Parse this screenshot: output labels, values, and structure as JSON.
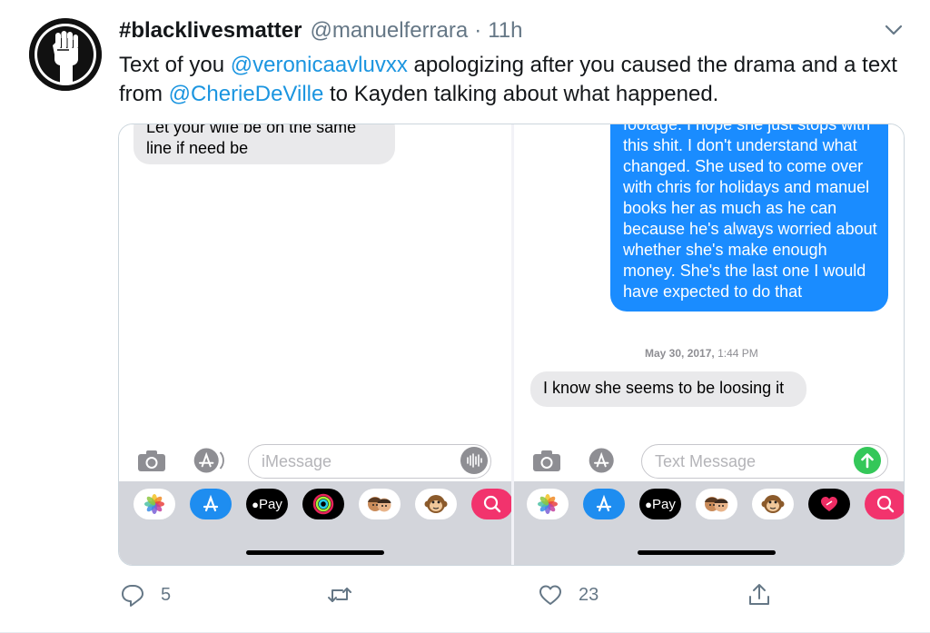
{
  "tweet": {
    "display_name": "#blacklivesmatter",
    "handle": "@manuelferrara",
    "separator": "·",
    "time": "11h",
    "text_parts": {
      "t1": "Text of you ",
      "m1": "@veronicaavluvxx",
      "t2": " apologizing after you caused the drama and a text from ",
      "m2": "@CherieDeVille",
      "t3": " to Kayden talking about what happened."
    }
  },
  "screenshot_left": {
    "bubble_top": "Let your wife be on the same line if need be",
    "input_placeholder": "iMessage",
    "icons": [
      "camera-icon",
      "app-store-icon",
      "audio-icon"
    ],
    "tray_icons": [
      "photos-icon",
      "app-store-icon",
      "apple-pay-icon",
      "activity-icon",
      "memoji-icon",
      "monkey-icon",
      "search-icon"
    ],
    "apple_pay_label": "Pay"
  },
  "screenshot_right": {
    "bubble_blue": "footage. I hope she just stops with this shit. I don't understand what changed. She used to come over with chris for holidays and manuel books her as much as he can because he's always worried about whether she's make enough money. She's the last one I would have expected to do that",
    "timestamp_date": "May 30, 2017,",
    "timestamp_time": "1:44 PM",
    "bubble_gray": "I know she seems to be loosing it",
    "input_placeholder": "Text Message",
    "icons": [
      "camera-icon",
      "app-store-icon",
      "send-icon"
    ],
    "tray_icons": [
      "photos-icon",
      "app-store-icon",
      "apple-pay-icon",
      "memoji-icon",
      "monkey-icon",
      "heart-icon",
      "search-icon"
    ],
    "apple_pay_label": "Pay"
  },
  "actions": {
    "reply_count": "5",
    "retweet_count": "",
    "like_count": "23"
  },
  "colors": {
    "link": "#1b95e0",
    "imessage_blue": "#1a8cff",
    "send_green": "#34c759",
    "muted": "#657786"
  }
}
